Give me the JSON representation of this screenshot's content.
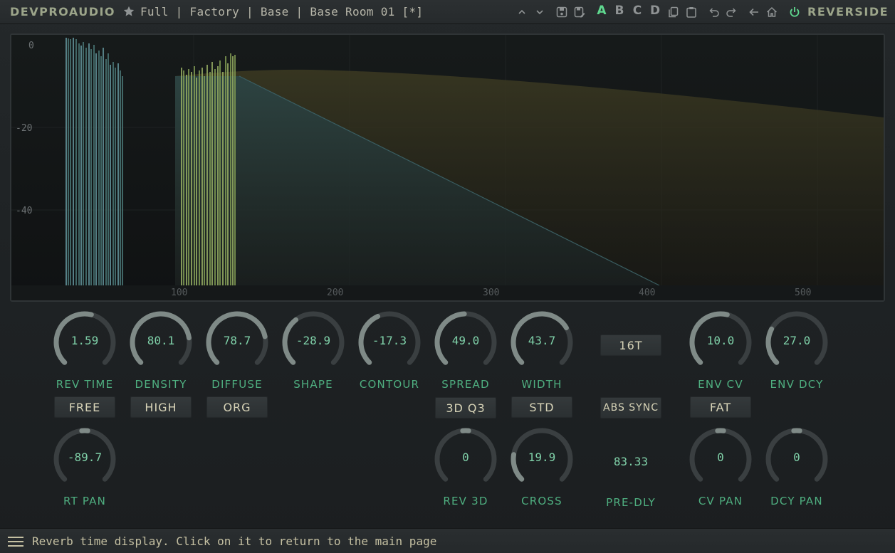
{
  "app": {
    "brand": "DEVPROAUDIO",
    "product": "REVERSIDE"
  },
  "preset": {
    "path": "Full | Factory | Base | Base Room 01 [*]"
  },
  "toolbar": {
    "ab_slots": [
      "A",
      "B",
      "C",
      "D"
    ],
    "active_slot": "A",
    "icons": [
      "chevron-up-icon",
      "chevron-down-icon",
      "save-icon",
      "save-as-icon",
      "copy-icon",
      "paste-icon",
      "undo-icon",
      "redo-icon",
      "back-arrow-icon",
      "home-icon",
      "power-icon"
    ]
  },
  "display": {
    "y_ticks": [
      "0",
      "-20",
      "-40"
    ],
    "x_ticks": [
      "100",
      "200",
      "300",
      "400",
      "500"
    ]
  },
  "knobs": {
    "rev_time": {
      "value": "1.59",
      "label": "REV TIME",
      "level": 0.55
    },
    "density": {
      "value": "80.1",
      "label": "DENSITY",
      "level": 0.8
    },
    "diffuse": {
      "value": "78.7",
      "label": "DIFFUSE",
      "level": 0.79
    },
    "shape": {
      "value": "-28.9",
      "label": "SHAPE",
      "level": 0.36
    },
    "contour": {
      "value": "-17.3",
      "label": "CONTOUR",
      "level": 0.41
    },
    "spread": {
      "value": "49.0",
      "label": "SPREAD",
      "level": 0.49
    },
    "width": {
      "value": "43.7",
      "label": "WIDTH",
      "level": 0.72
    },
    "env_cv": {
      "value": "10.0",
      "label": "ENV CV",
      "level": 0.55
    },
    "env_dcy": {
      "value": "27.0",
      "label": "ENV DCY",
      "level": 0.27
    },
    "rt_pan": {
      "value": "-89.7",
      "label": "RT PAN",
      "level": 0.5
    },
    "rev_3d": {
      "value": "0",
      "label": "REV 3D",
      "level": 0.5
    },
    "cross": {
      "value": "19.9",
      "label": "CROSS",
      "level": 0.2
    },
    "cv_pan": {
      "value": "0",
      "label": "CV PAN",
      "level": 0.5
    },
    "dcy_pan": {
      "value": "0",
      "label": "DCY PAN",
      "level": 0.5
    }
  },
  "buttons": {
    "free": "FREE",
    "high": "HIGH",
    "org": "ORG",
    "3d_q3": "3D Q3",
    "std": "STD",
    "sixteen_t": "16T",
    "abs_sync": "ABS SYNC",
    "fat": "FAT"
  },
  "pre_dly": {
    "value": "83.33",
    "label": "PRE-DLY"
  },
  "status": {
    "text": "Reverb time display. Click on it to return to the main page"
  },
  "colors": {
    "accent": "#5fd88f",
    "knob_value": "#7fd0a8",
    "label": "#4faf80",
    "arc_fill": "#7f8a87",
    "arc_track": "#3a3f41"
  }
}
